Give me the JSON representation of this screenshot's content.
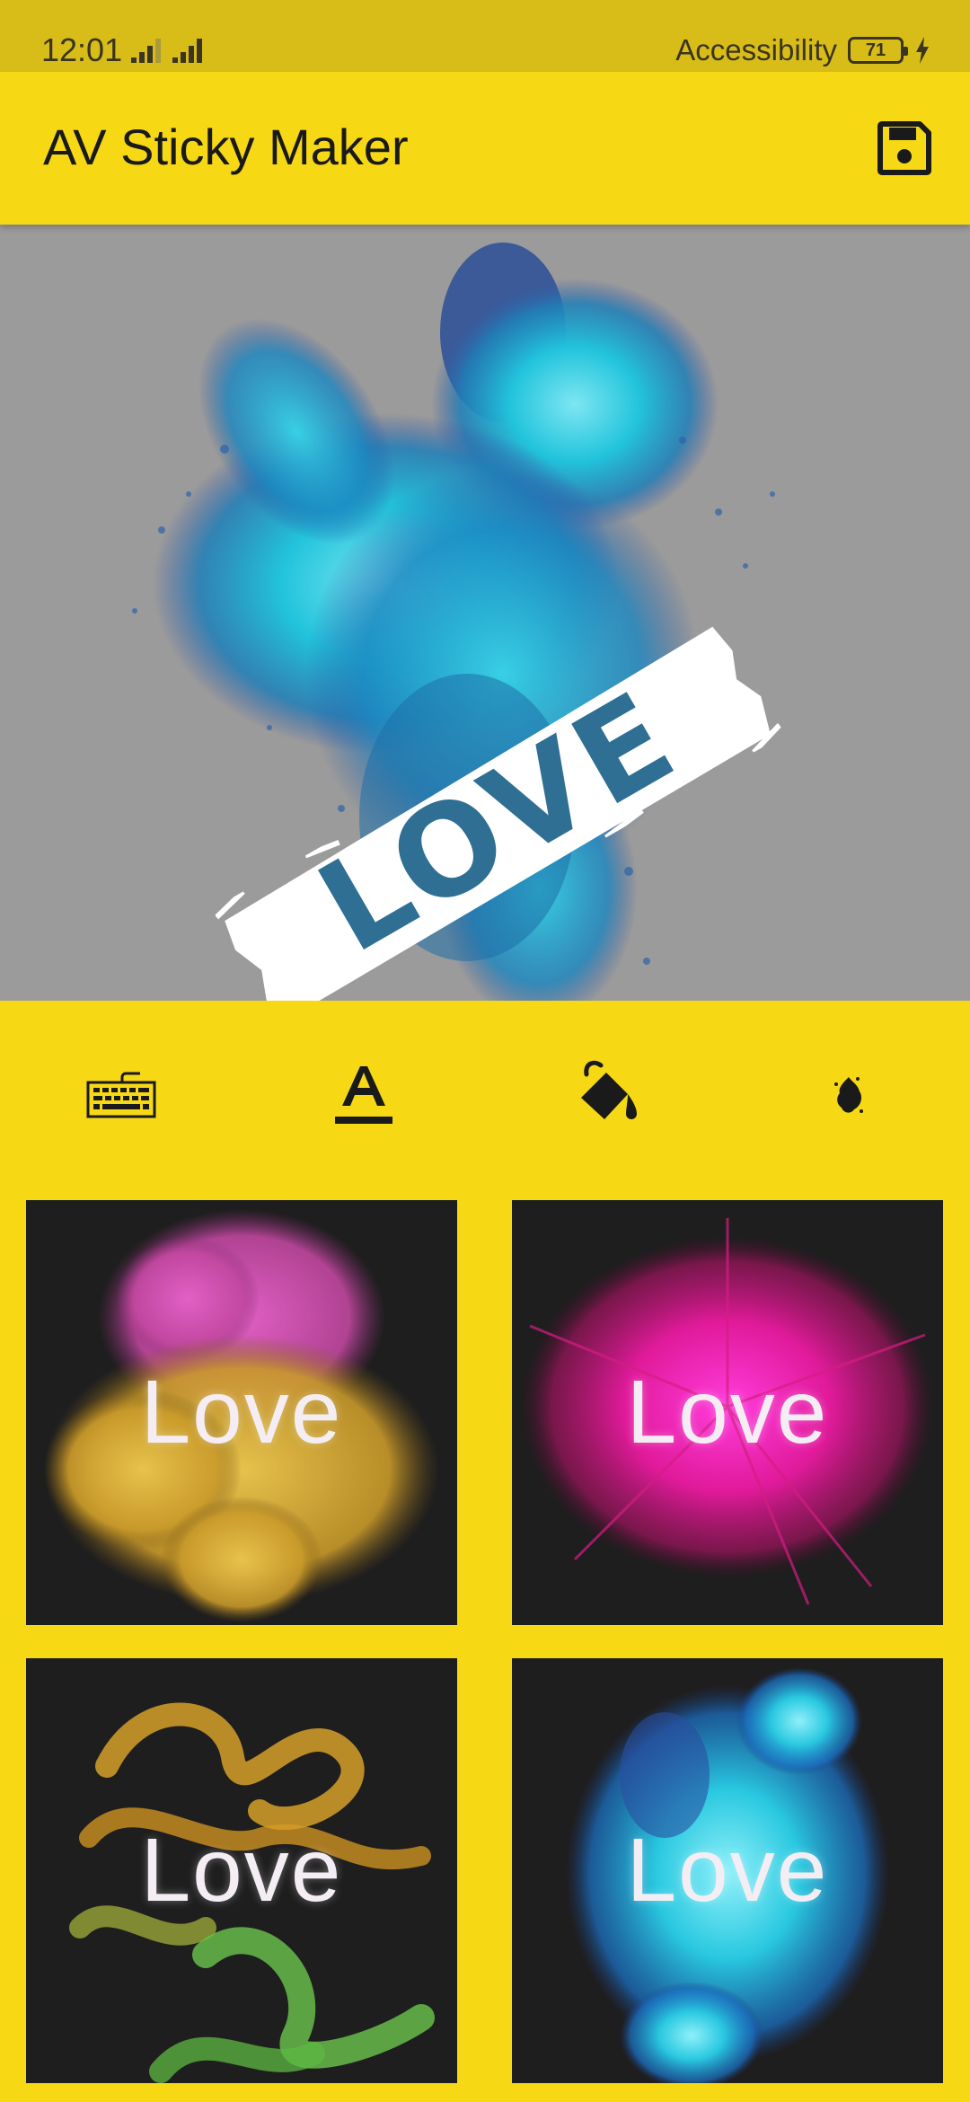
{
  "status_bar": {
    "time": "12:01",
    "right_label": "Accessibility",
    "battery_level": "71"
  },
  "app_bar": {
    "title": "AV Sticky Maker",
    "save_icon": "save-icon"
  },
  "canvas": {
    "sticker_text": "LOVE",
    "background": "#9b9b9b",
    "splash_colors": [
      "#22c4dc",
      "#1f7fb8",
      "#3558a8"
    ]
  },
  "tools": [
    {
      "icon": "keyboard-icon"
    },
    {
      "icon": "text-format-icon"
    },
    {
      "icon": "paint-bucket-icon"
    },
    {
      "icon": "ink-splash-icon"
    }
  ],
  "styles": [
    {
      "label": "Love",
      "colors": [
        "#d850b8",
        "#d9b33a"
      ]
    },
    {
      "label": "Love",
      "colors": [
        "#e01a9a",
        "#c21e6e"
      ]
    },
    {
      "label": "Love",
      "colors": [
        "#e0a82b",
        "#6bc44c"
      ]
    },
    {
      "label": "Love",
      "colors": [
        "#29c8e0",
        "#1b6fc0"
      ]
    }
  ],
  "theme": {
    "accent": "#f7d815",
    "status_bar": "#d8bd19",
    "card_background": "#1e1e1e"
  }
}
